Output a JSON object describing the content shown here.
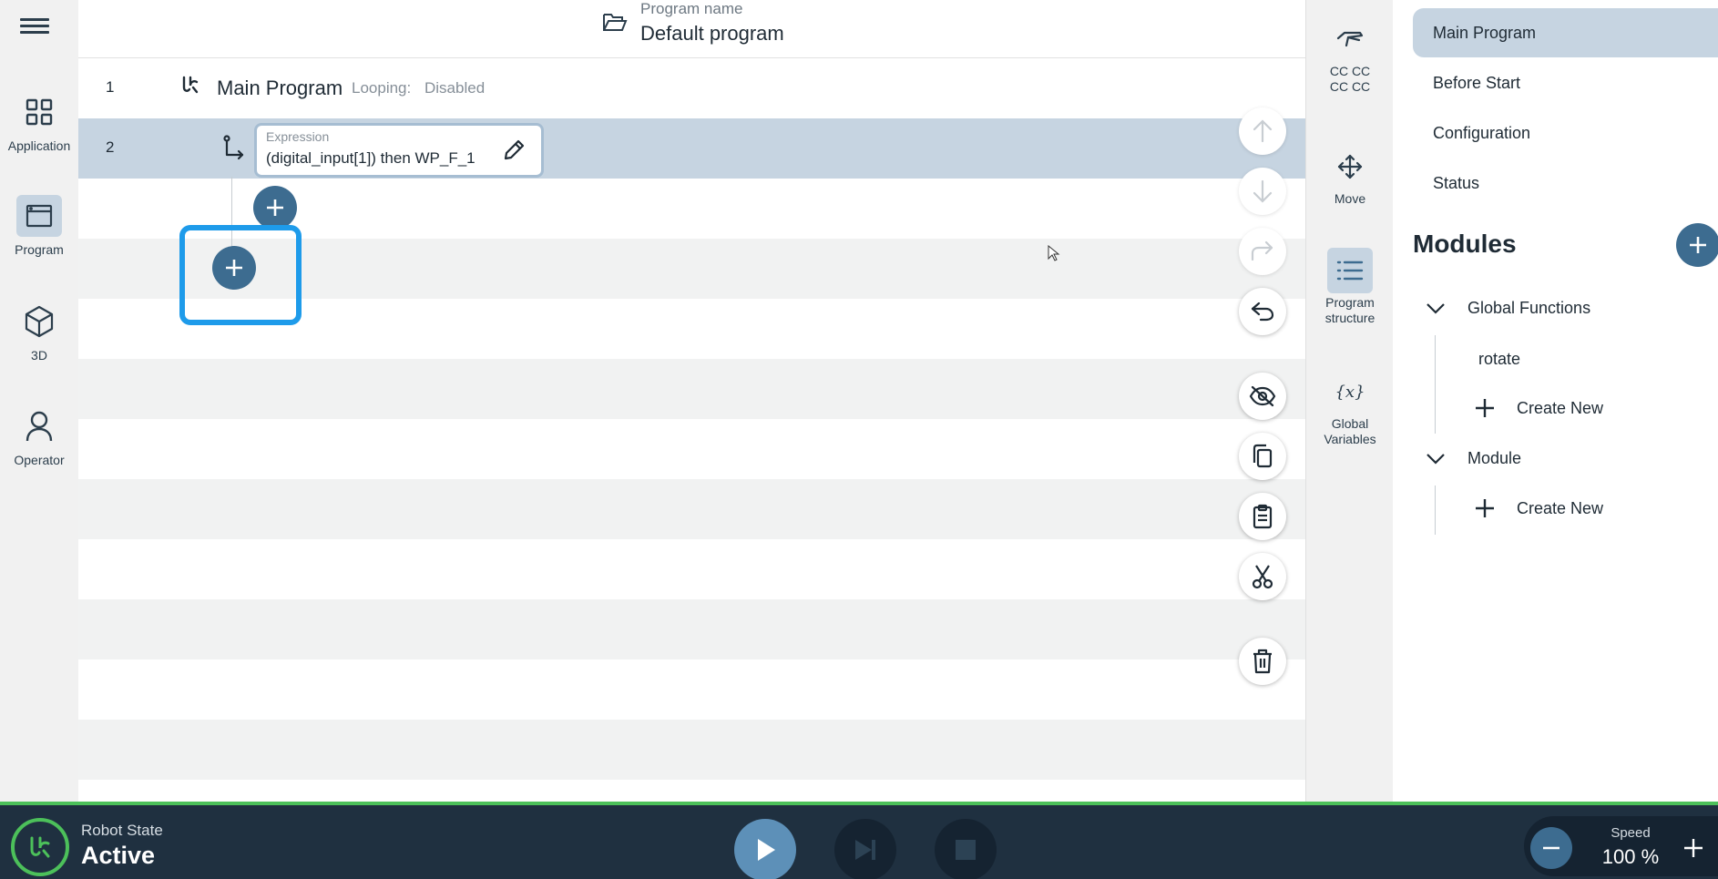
{
  "header": {
    "program_name_label": "Program name",
    "program_name_value": "Default program"
  },
  "leftnav": {
    "items": [
      {
        "label": "Application",
        "icon": "grid-icon"
      },
      {
        "label": "Program",
        "icon": "program-window-icon",
        "active": true
      },
      {
        "label": "3D",
        "icon": "cube-icon"
      },
      {
        "label": "Operator",
        "icon": "person-icon"
      }
    ]
  },
  "program": {
    "rows": [
      {
        "number": "1",
        "title": "Main Program",
        "looping_label": "Looping:",
        "looping_value": "Disabled"
      },
      {
        "number": "2",
        "expression_label": "Expression",
        "expression_value": "(digital_input[1]) then WP_F_1"
      }
    ]
  },
  "tools": {
    "items": [
      {
        "label_line1": "CC CC",
        "label_line2": "CC CC",
        "icon": "gripper-icon"
      },
      {
        "label_line1": "Move",
        "label_line2": "",
        "icon": "move-arrows-icon"
      },
      {
        "label_line1": "Program",
        "label_line2": "structure",
        "icon": "list-icon",
        "active": true
      },
      {
        "label_line1": "Global",
        "label_line2": "Variables",
        "icon": "variable-x-icon"
      }
    ]
  },
  "panel": {
    "items": [
      "Main Program",
      "Before Start",
      "Configuration",
      "Status"
    ],
    "modules_title": "Modules",
    "groups": [
      {
        "name": "Global Functions",
        "children": [
          "rotate"
        ],
        "create_new": "Create New"
      },
      {
        "name": "Module",
        "children": [],
        "create_new": "Create New"
      }
    ]
  },
  "bottombar": {
    "robot_state_label": "Robot State",
    "robot_state_value": "Active",
    "speed_label": "Speed",
    "speed_value": "100 %"
  },
  "colors": {
    "accent": "#3d6c90",
    "selected_row": "#c6d4e1",
    "focus_ring": "#1e9bea",
    "bottom_bar": "#1f3040",
    "status_green": "#4cc05a"
  }
}
